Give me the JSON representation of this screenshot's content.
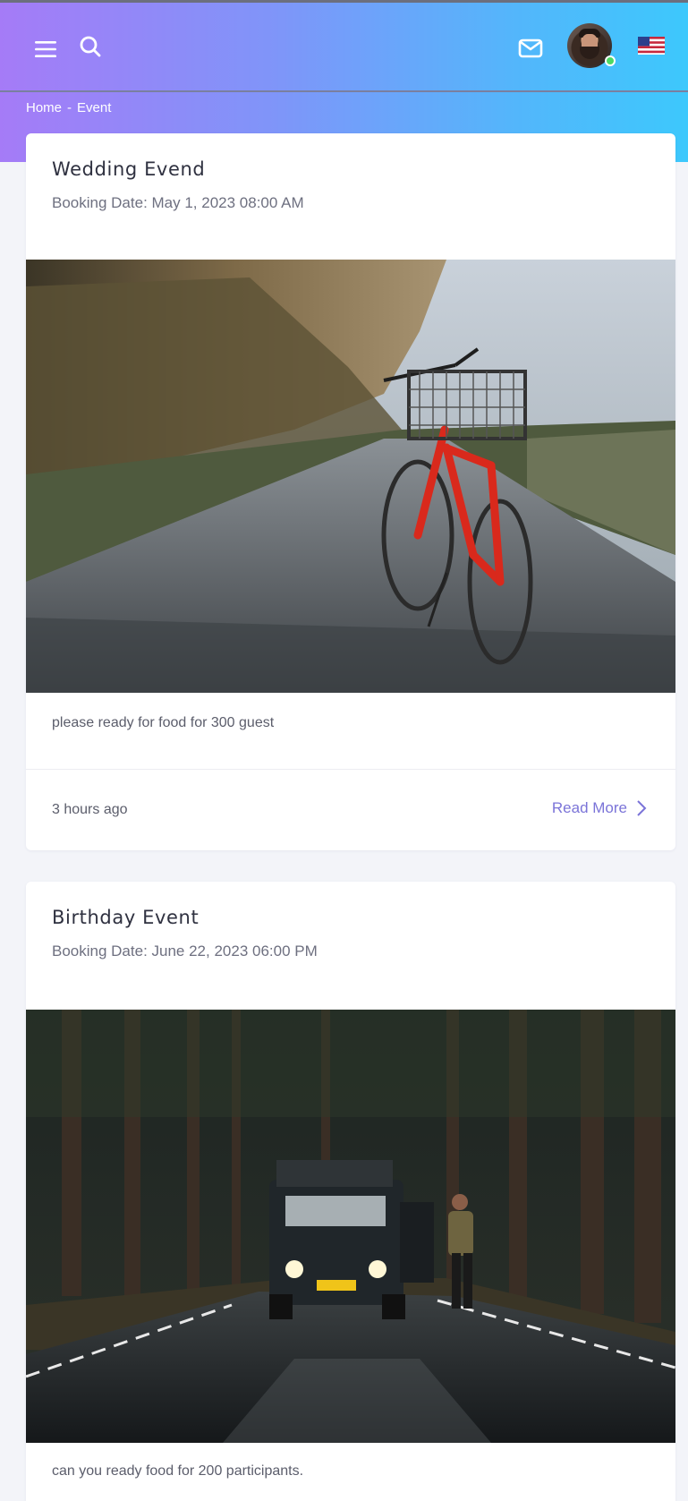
{
  "breadcrumb": {
    "home": "Home",
    "separator": "-",
    "current": "Event"
  },
  "header": {
    "icons": [
      "menu-icon",
      "search-icon",
      "mail-icon",
      "us-flag-icon"
    ],
    "accent_colors": [
      "#a57bf7",
      "#3dc8fc"
    ],
    "user_status": "online"
  },
  "events": [
    {
      "title": "Wedding Evend",
      "booking_date": "Booking Date: May 1, 2023 08:00 AM",
      "image": "red bicycle with basket on a country road",
      "description": "please ready for food for 300 guest",
      "time": "3 hours ago",
      "read_more": "Read More"
    },
    {
      "title": "Birthday Event",
      "booking_date": "Booking Date: June 22, 2023 06:00 PM",
      "image": "off-road vehicle with headlights on a forest road and a man standing beside it",
      "description": "can you ready food for 200 participants."
    }
  ]
}
